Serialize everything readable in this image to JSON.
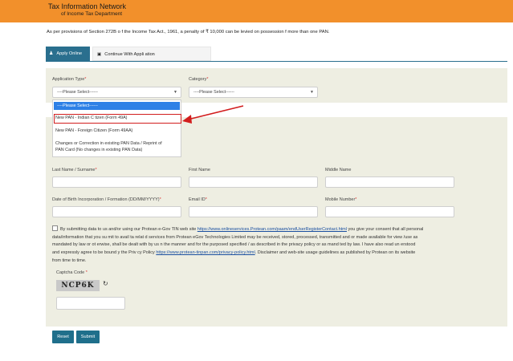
{
  "header": {
    "title": "Tax Information Network",
    "subtitle": "of Income Tax Department"
  },
  "notice": "As per provisions of Section 272B o   f the Income Tax Act., 1961, a penalty of ₹ 10,000 can be levied on possession   f more than one PAN.",
  "tabs": {
    "apply_online": "Apply Online",
    "continue_with_application": "Continue With Appli   ation"
  },
  "form": {
    "application_type_label": "Application Type",
    "application_type_value": "----Please Select------",
    "category_label": "Category",
    "category_value": "----Please Select------",
    "dropdown_options": [
      "----Please Select------",
      "New PAN - Indian C tizen (Form 49A)",
      "New PAN - Foreign Citizen (Form 49AA)",
      "Changes or Correction in existing PAN Data / Reprint of",
      "PAN Card (No changes in existing PAN Data)"
    ],
    "last_name_label": "Last Name / Surname",
    "first_name_label": "First Name",
    "middle_name_label": "Middle Name",
    "dob_label": "Date of Birth   Incorporation / Formation (DD/MM/YYYY)",
    "email_label": "Email ID",
    "mobile_label": "Mobile Number",
    "required_mark": "*"
  },
  "consent": {
    "line1_pre": "By submitting data to us and/or using our Protean e-Gov TIN web site ",
    "link1": "https://www.onlineservices.Protean.com/paam/endUserRegisterContact.html",
    "line1_post": " you give your consent that all personal",
    "line2": "data/information that you su  mit to avail ta  relat  d services from Protean eGov Technologies Limited may be received, stored, processed, transmitted and or made available for view /use as",
    "line3": "mandated by law or ot  erwise, shall be dealt with by us  n the manner and for the purposed specified / as described in the privacy policy or as mand  ted by law. I have also read  un erstood",
    "line4_pre": "and expressly agree to be bound  y the Priv  cy Policy ",
    "link2": "https://www.protean-tinpan.com/privacy-policy.html",
    "line4_post": ". Disclaimer and web-site usage guidelines as published by Protean on its website",
    "line5": "from time to time."
  },
  "captcha": {
    "label": "Captcha Code",
    "required_mark": "*",
    "image_text": "NCP6K",
    "refresh_icon": "refresh-icon"
  },
  "buttons": {
    "reset": "Reset",
    "submit": "Submit"
  },
  "colors": {
    "header_orange": "#f2902b",
    "primary_teal": "#2a6f8e",
    "panel_beige": "#eeeee2",
    "highlight_red": "#d21d1d",
    "selected_blue": "#2e80e6"
  }
}
